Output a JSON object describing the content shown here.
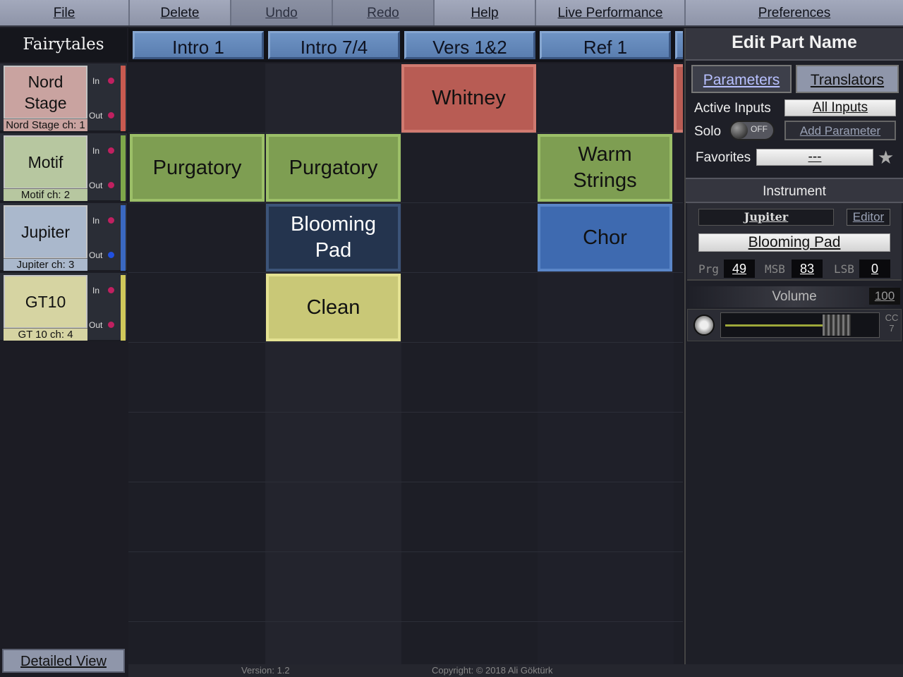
{
  "menu": {
    "file": "File",
    "delete": "Delete",
    "undo": "Undo",
    "redo": "Redo",
    "help": "Help",
    "live": "Live Performance",
    "prefs": "Preferences"
  },
  "song_title": "Fairytales",
  "tracks": [
    {
      "name": "Nord Stage",
      "channel": "Nord Stage ch: 1",
      "in": "In",
      "out": "Out",
      "color": "#c9a3a0",
      "stripe": "#c85a50",
      "led_in": "#c02060",
      "led_out": "#c02060"
    },
    {
      "name": "Motif",
      "channel": "Motif ch: 2",
      "in": "In",
      "out": "Out",
      "color": "#b7c7a0",
      "stripe": "#7ea64a",
      "led_in": "#c02060",
      "led_out": "#c02060"
    },
    {
      "name": "Jupiter",
      "channel": "Jupiter ch: 3",
      "in": "In",
      "out": "Out",
      "color": "#aab8cc",
      "stripe": "#3a68c0",
      "led_in": "#c02060",
      "led_out": "#2050e0"
    },
    {
      "name": "GT10",
      "channel": "GT 10 ch: 4",
      "in": "In",
      "out": "Out",
      "color": "#d6d4a2",
      "stripe": "#d0c85a",
      "led_in": "#c02060",
      "led_out": "#c02060"
    }
  ],
  "sections": [
    "Intro 1",
    "Intro 7/4",
    "Vers 1&2",
    "Ref 1"
  ],
  "cells": [
    {
      "label": "Whitney",
      "color": "#b85c54",
      "border": "#d07a70"
    },
    {
      "label": "Purgatory",
      "color": "#7e9e52",
      "border": "#9cbf68"
    },
    {
      "label": "Purgatory",
      "color": "#7e9e52",
      "border": "#9cbf68"
    },
    {
      "label": "Warm Strings",
      "color": "#7e9e52",
      "border": "#9cbf68"
    },
    {
      "label": "Blooming Pad",
      "color": "#24344e",
      "border": "#3c5478"
    },
    {
      "label": "Chor",
      "color": "#3e6ab0",
      "border": "#5a86c8"
    },
    {
      "label": "Clean",
      "color": "#c9c877",
      "border": "#e4e292"
    }
  ],
  "detail_view": "Detailed View",
  "panel": {
    "title": "Edit Part Name",
    "tab_parameters": "Parameters",
    "tab_translators": "Translators",
    "active_inputs_label": "Active Inputs",
    "active_inputs_value": "All Inputs",
    "solo_label": "Solo",
    "solo_state": "OFF",
    "add_parameter": "Add Parameter",
    "favorites_label": "Favorites",
    "favorites_value": "---",
    "instrument_header": "Instrument",
    "instrument_name": "Jupiter",
    "editor": "Editor",
    "patch": "Blooming Pad",
    "prg_label": "Prg",
    "prg": "49",
    "msb_label": "MSB",
    "msb": "83",
    "lsb_label": "LSB",
    "lsb": "0",
    "volume_label": "Volume",
    "volume": "100",
    "volume_level": 0.79,
    "cc_label": "CC 7"
  },
  "footer": {
    "version": "Version: 1.2",
    "copyright": "Copyright: © 2018 Ali Göktürk"
  }
}
